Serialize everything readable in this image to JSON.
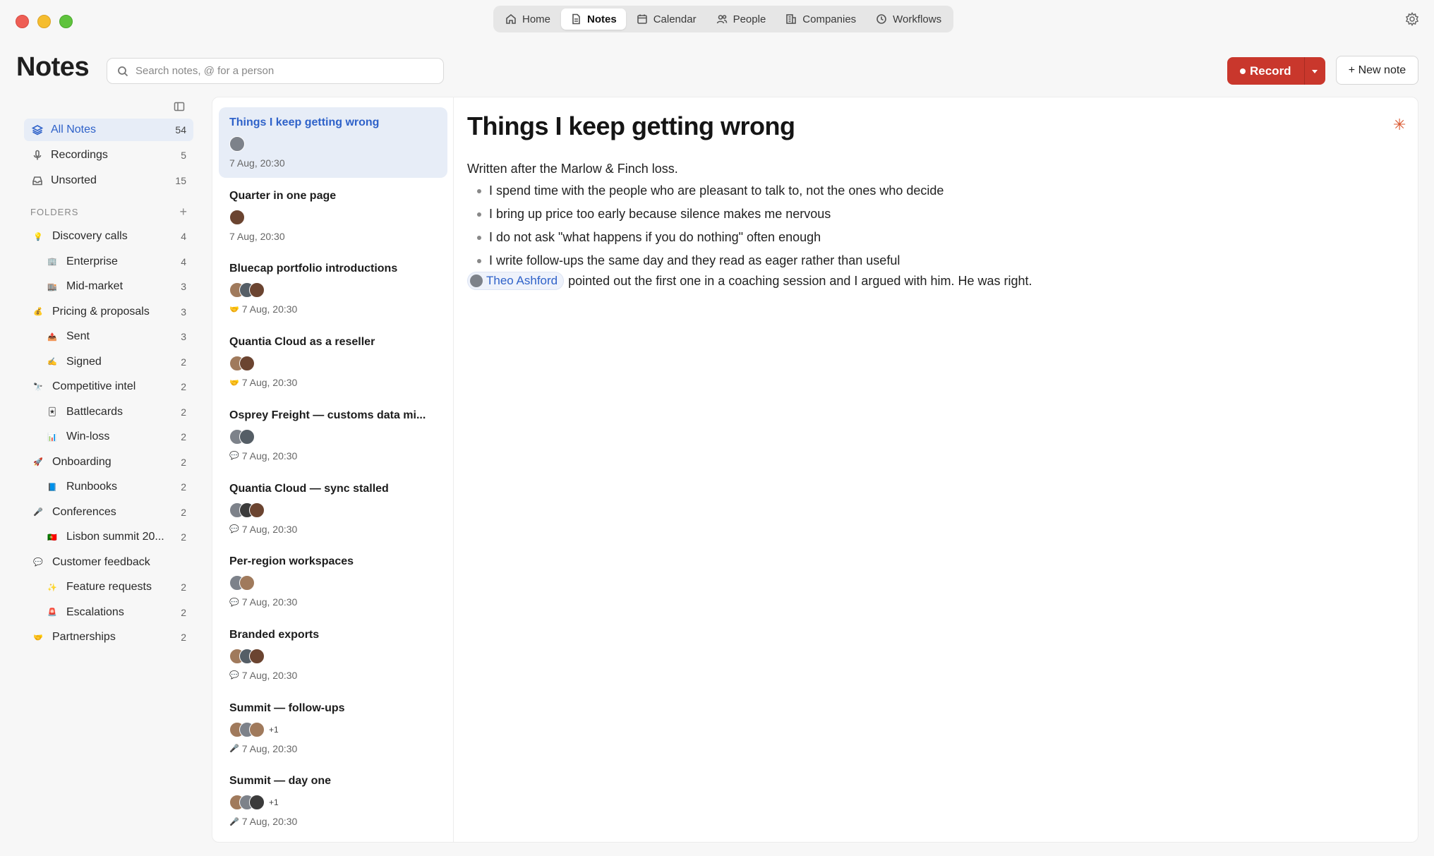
{
  "topnav": {
    "tabs": [
      {
        "label": "Home",
        "icon": "home-icon"
      },
      {
        "label": "Notes",
        "icon": "document-icon"
      },
      {
        "label": "Calendar",
        "icon": "calendar-icon"
      },
      {
        "label": "People",
        "icon": "people-icon"
      },
      {
        "label": "Companies",
        "icon": "building-icon"
      },
      {
        "label": "Workflows",
        "icon": "clock-icon"
      }
    ],
    "active": "Notes"
  },
  "header": {
    "title": "Notes",
    "search_placeholder": "Search notes, @ for a person",
    "record_label": "Record",
    "new_note_label": "+ New note"
  },
  "sidebar": {
    "items": [
      {
        "label": "All Notes",
        "count": "54",
        "icon": "layers-icon"
      },
      {
        "label": "Recordings",
        "count": "5",
        "icon": "mic-icon"
      },
      {
        "label": "Unsorted",
        "count": "15",
        "icon": "inbox-icon"
      }
    ],
    "folders_heading": "FOLDERS",
    "folders": [
      {
        "label": "Discovery calls",
        "count": "4",
        "emoji": "💡",
        "level": 0
      },
      {
        "label": "Enterprise",
        "count": "4",
        "emoji": "🏢",
        "level": 1
      },
      {
        "label": "Mid-market",
        "count": "3",
        "emoji": "🏬",
        "level": 1
      },
      {
        "label": "Pricing & proposals",
        "count": "3",
        "emoji": "💰",
        "level": 0
      },
      {
        "label": "Sent",
        "count": "3",
        "emoji": "📤",
        "level": 1
      },
      {
        "label": "Signed",
        "count": "2",
        "emoji": "✍️",
        "level": 1
      },
      {
        "label": "Competitive intel",
        "count": "2",
        "emoji": "🔭",
        "level": 0
      },
      {
        "label": "Battlecards",
        "count": "2",
        "emoji": "🃏",
        "level": 1
      },
      {
        "label": "Win-loss",
        "count": "2",
        "emoji": "📊",
        "level": 1
      },
      {
        "label": "Onboarding",
        "count": "2",
        "emoji": "🚀",
        "level": 0
      },
      {
        "label": "Runbooks",
        "count": "2",
        "emoji": "📘",
        "level": 1
      },
      {
        "label": "Conferences",
        "count": "2",
        "emoji": "🎤",
        "level": 0
      },
      {
        "label": "Lisbon summit 20...",
        "count": "2",
        "emoji": "🇵🇹",
        "level": 1
      },
      {
        "label": "Customer feedback",
        "count": "",
        "emoji": "💬",
        "level": 0
      },
      {
        "label": "Feature requests",
        "count": "2",
        "emoji": "✨",
        "level": 1
      },
      {
        "label": "Escalations",
        "count": "2",
        "emoji": "🚨",
        "level": 1
      },
      {
        "label": "Partnerships",
        "count": "2",
        "emoji": "🤝",
        "level": 0
      }
    ]
  },
  "notes": [
    {
      "title": "Things I keep getting wrong",
      "avatars": [
        "av1"
      ],
      "more": "",
      "meta_icon": "",
      "meta": "7 Aug, 20:30"
    },
    {
      "title": "Quarter in one page",
      "avatars": [
        "av2"
      ],
      "more": "",
      "meta_icon": "",
      "meta": "7 Aug, 20:30"
    },
    {
      "title": "Bluecap portfolio introductions",
      "avatars": [
        "av4",
        "av5",
        "av2"
      ],
      "more": "",
      "meta_icon": "🤝",
      "meta": "7 Aug, 20:30"
    },
    {
      "title": "Quantia Cloud as a reseller",
      "avatars": [
        "av4",
        "av2"
      ],
      "more": "",
      "meta_icon": "🤝",
      "meta": "7 Aug, 20:30"
    },
    {
      "title": "Osprey Freight — customs data mi...",
      "avatars": [
        "av1",
        "av5"
      ],
      "more": "",
      "meta_icon": "💬",
      "meta": "7 Aug, 20:30"
    },
    {
      "title": "Quantia Cloud — sync stalled",
      "avatars": [
        "av1",
        "av3",
        "av2"
      ],
      "more": "",
      "meta_icon": "💬",
      "meta": "7 Aug, 20:30"
    },
    {
      "title": "Per-region workspaces",
      "avatars": [
        "av1",
        "av4"
      ],
      "more": "",
      "meta_icon": "💬",
      "meta": "7 Aug, 20:30"
    },
    {
      "title": "Branded exports",
      "avatars": [
        "av4",
        "av5",
        "av2"
      ],
      "more": "",
      "meta_icon": "💬",
      "meta": "7 Aug, 20:30"
    },
    {
      "title": "Summit — follow-ups",
      "avatars": [
        "av4",
        "av1",
        "av4"
      ],
      "more": "+1",
      "meta_icon": "🎤",
      "meta": "7 Aug, 20:30"
    },
    {
      "title": "Summit — day one",
      "avatars": [
        "av4",
        "av1",
        "av3"
      ],
      "more": "+1",
      "meta_icon": "🎤",
      "meta": "7 Aug, 20:30"
    }
  ],
  "document": {
    "title": "Things I keep getting wrong",
    "intro": "Written after the Marlow & Finch loss.",
    "bullets": [
      "I spend time with the people who are pleasant to talk to, not the ones who decide",
      "I bring up price too early because silence makes me nervous",
      "I do not ask \"what happens if you do nothing\" often enough",
      "I write follow-ups the same day and they read as eager rather than useful"
    ],
    "mention": "Theo Ashford",
    "closing": "pointed out the first one in a coaching session and I argued with him. He was right."
  },
  "colors": {
    "accent": "#2f62c9",
    "record": "#c9372c",
    "active_bg": "#e7edf7"
  }
}
